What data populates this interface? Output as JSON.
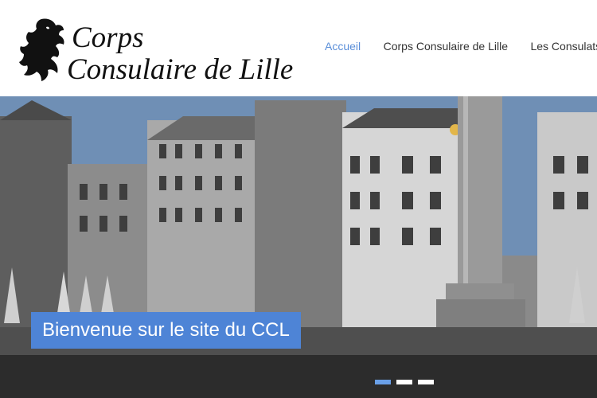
{
  "site": {
    "logo_line1": "Corps",
    "logo_line2": "Consulaire de Lille",
    "logo_emblem": "lion-rampant-icon"
  },
  "nav": {
    "items": [
      {
        "label": "Accueil",
        "active": true
      },
      {
        "label": "Corps Consulaire de Lille",
        "active": false
      },
      {
        "label": "Les Consulats",
        "active": false
      }
    ]
  },
  "hero": {
    "caption": "Bienvenue sur le site du CCL",
    "slide_count": 3,
    "active_slide": 1
  },
  "colors": {
    "accent": "#4e84d6",
    "nav_active": "#5b8fd9",
    "nav_text": "#333333",
    "hero_tint": "#8a8a8a"
  }
}
